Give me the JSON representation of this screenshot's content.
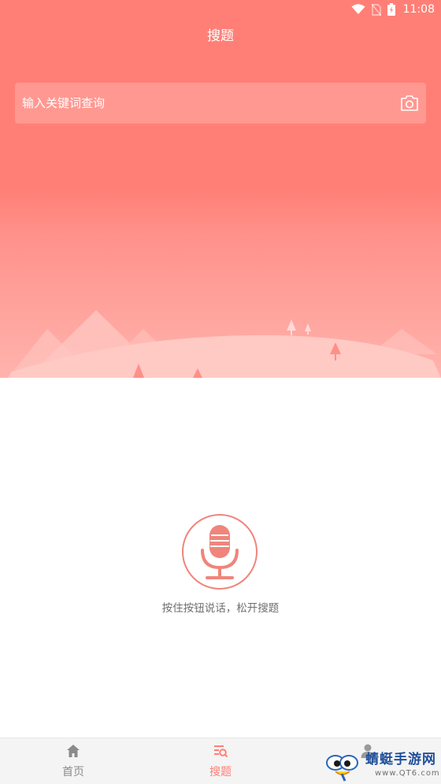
{
  "status_bar": {
    "time": "11:08"
  },
  "header": {
    "title": "搜题"
  },
  "search": {
    "placeholder": "输入关键词查询"
  },
  "voice": {
    "hint": "按住按钮说话，松开搜题"
  },
  "tabs": [
    {
      "label": "首页",
      "icon": "home-icon"
    },
    {
      "label": "搜题",
      "icon": "search-list-icon",
      "active": true
    },
    {
      "label": "",
      "icon": "user-icon"
    }
  ],
  "watermark": {
    "text": "蜻蜓手游网",
    "sub": "www.QT6.com"
  },
  "colors": {
    "accent": "#ff7f76",
    "tab_inactive": "#8b8b8b"
  }
}
